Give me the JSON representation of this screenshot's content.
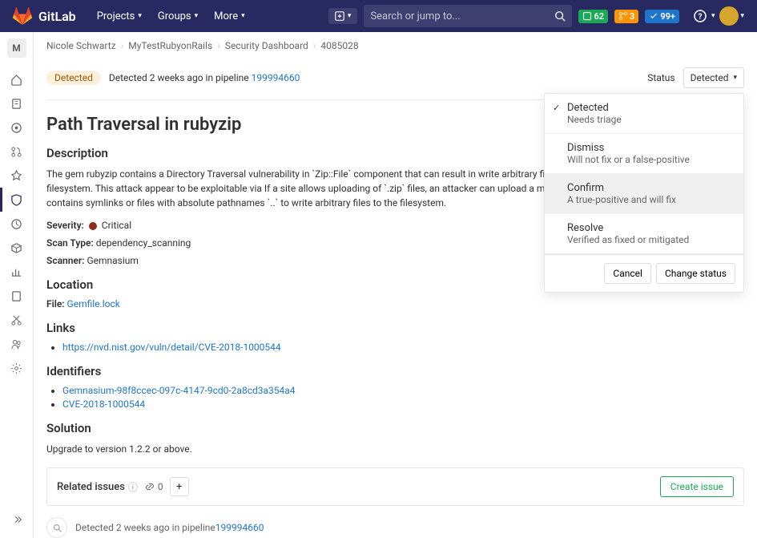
{
  "nav": {
    "brand": "GitLab",
    "items": [
      "Projects",
      "Groups",
      "More"
    ],
    "search_placeholder": "Search or jump to...",
    "badges": {
      "issues": "62",
      "merge": "3",
      "todos": "99+"
    }
  },
  "sidebar": {
    "project_letter": "M"
  },
  "breadcrumbs": [
    "Nicole Schwartz",
    "MyTestRubyonRails",
    "Security Dashboard",
    "4085028"
  ],
  "header": {
    "badge": "Detected",
    "text_prefix": "Detected 2 weeks ago in pipeline ",
    "pipeline": "199994660",
    "status_label": "Status",
    "status_value": "Detected"
  },
  "status_options": [
    {
      "title": "Detected",
      "sub": "Needs triage",
      "checked": true
    },
    {
      "title": "Dismiss",
      "sub": "Will not fix or a false-positive"
    },
    {
      "title": "Confirm",
      "sub": "A true-positive and will fix",
      "hover": true
    },
    {
      "title": "Resolve",
      "sub": "Verified as fixed or mitigated"
    }
  ],
  "status_footer": {
    "cancel": "Cancel",
    "change": "Change status"
  },
  "title": "Path Traversal in rubyzip",
  "sections": {
    "description": "Description",
    "location": "Location",
    "links": "Links",
    "identifiers": "Identifiers",
    "solution": "Solution"
  },
  "description_text": "The gem rubyzip contains a Directory Traversal vulnerability in `Zip::File` component that can result in write arbitrary files to the filesystem. This attack appear to be exploitable via If a site allows uploading of `.zip` files, an attacker can upload a malicious file that contains symlinks or files with absolute pathnames `..` to write arbitrary files to the filesystem.",
  "meta": {
    "severity_label": "Severity:",
    "severity_value": "Critical",
    "scan_type_label": "Scan Type:",
    "scan_type_value": "dependency_scanning",
    "scanner_label": "Scanner:",
    "scanner_value": "Gemnasium",
    "file_label": "File:",
    "file_value": "Gemfile.lock"
  },
  "links": [
    "https://nvd.nist.gov/vuln/detail/CVE-2018-1000544"
  ],
  "identifiers": [
    "Gemnasium-98f8ccec-097c-4147-9cd0-2a8cd3a354a4",
    "CVE-2018-1000544"
  ],
  "solution_text": "Upgrade to version 1.2.2 or above.",
  "related": {
    "label": "Related issues",
    "count": "0",
    "create": "Create issue"
  },
  "activity": {
    "text_prefix": "Detected 2 weeks ago in pipeline ",
    "pipeline": "199994660"
  }
}
